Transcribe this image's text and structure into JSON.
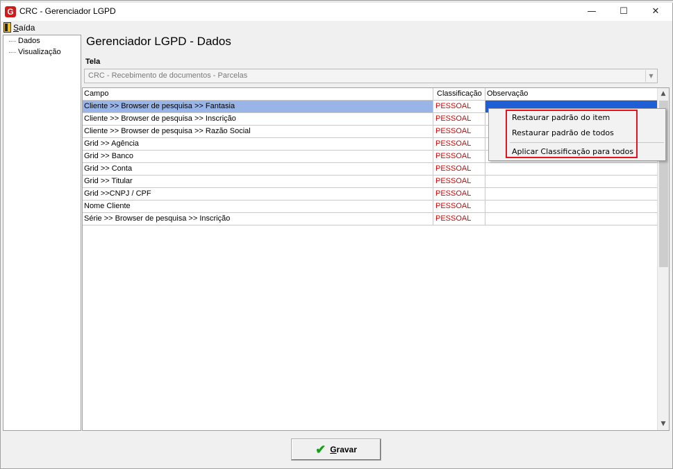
{
  "window": {
    "title": "CRC - Gerenciador LGPD",
    "app_icon_letter": "G",
    "minimize_glyph": "—",
    "maximize_glyph": "☐",
    "close_glyph": "✕"
  },
  "menu": {
    "exit_first": "S",
    "exit_rest": "aída",
    "exit_icon": "door-exit-icon"
  },
  "tree": {
    "items": [
      {
        "label": "Dados"
      },
      {
        "label": "Visualização"
      }
    ]
  },
  "main": {
    "title": "Gerenciador LGPD - Dados",
    "tela_label": "Tela",
    "tela_value": "CRC - Recebimento de documentos - Parcelas"
  },
  "grid": {
    "columns": [
      "Campo",
      "Classificação",
      "Observação"
    ],
    "rows": [
      {
        "campo": "Cliente >> Browser de pesquisa >> Fantasia",
        "classificacao": "PESSOAL",
        "observacao": ""
      },
      {
        "campo": "Cliente >> Browser de pesquisa >> Inscrição",
        "classificacao": "PESSOAL",
        "observacao": ""
      },
      {
        "campo": "Cliente >> Browser de pesquisa >> Razão Social",
        "classificacao": "PESSOAL",
        "observacao": ""
      },
      {
        "campo": "Grid >> Agência",
        "classificacao": "PESSOAL",
        "observacao": ""
      },
      {
        "campo": "Grid >> Banco",
        "classificacao": "PESSOAL",
        "observacao": ""
      },
      {
        "campo": "Grid >> Conta",
        "classificacao": "PESSOAL",
        "observacao": ""
      },
      {
        "campo": "Grid >> Titular",
        "classificacao": "PESSOAL",
        "observacao": ""
      },
      {
        "campo": "Grid >>CNPJ / CPF",
        "classificacao": "PESSOAL",
        "observacao": ""
      },
      {
        "campo": "Nome Cliente",
        "classificacao": "PESSOAL",
        "observacao": ""
      },
      {
        "campo": "Série >> Browser de pesquisa >> Inscrição",
        "classificacao": "PESSOAL",
        "observacao": ""
      }
    ],
    "selected_row": 0
  },
  "context_menu": {
    "items": [
      {
        "label": "Restaurar padrão do item"
      },
      {
        "label": "Restaurar padrão de todos"
      },
      {
        "label": "Aplicar Classificação para todos"
      }
    ]
  },
  "footer": {
    "gravar_first": "G",
    "gravar_rest": "ravar",
    "gravar_icon": "checkmark-icon"
  },
  "colors": {
    "selection_light": "#99b4e6",
    "selection_dark": "#1e5fd6",
    "classification_text": "#e00000",
    "highlight_border": "#e8121e",
    "check_green": "#16a016"
  }
}
